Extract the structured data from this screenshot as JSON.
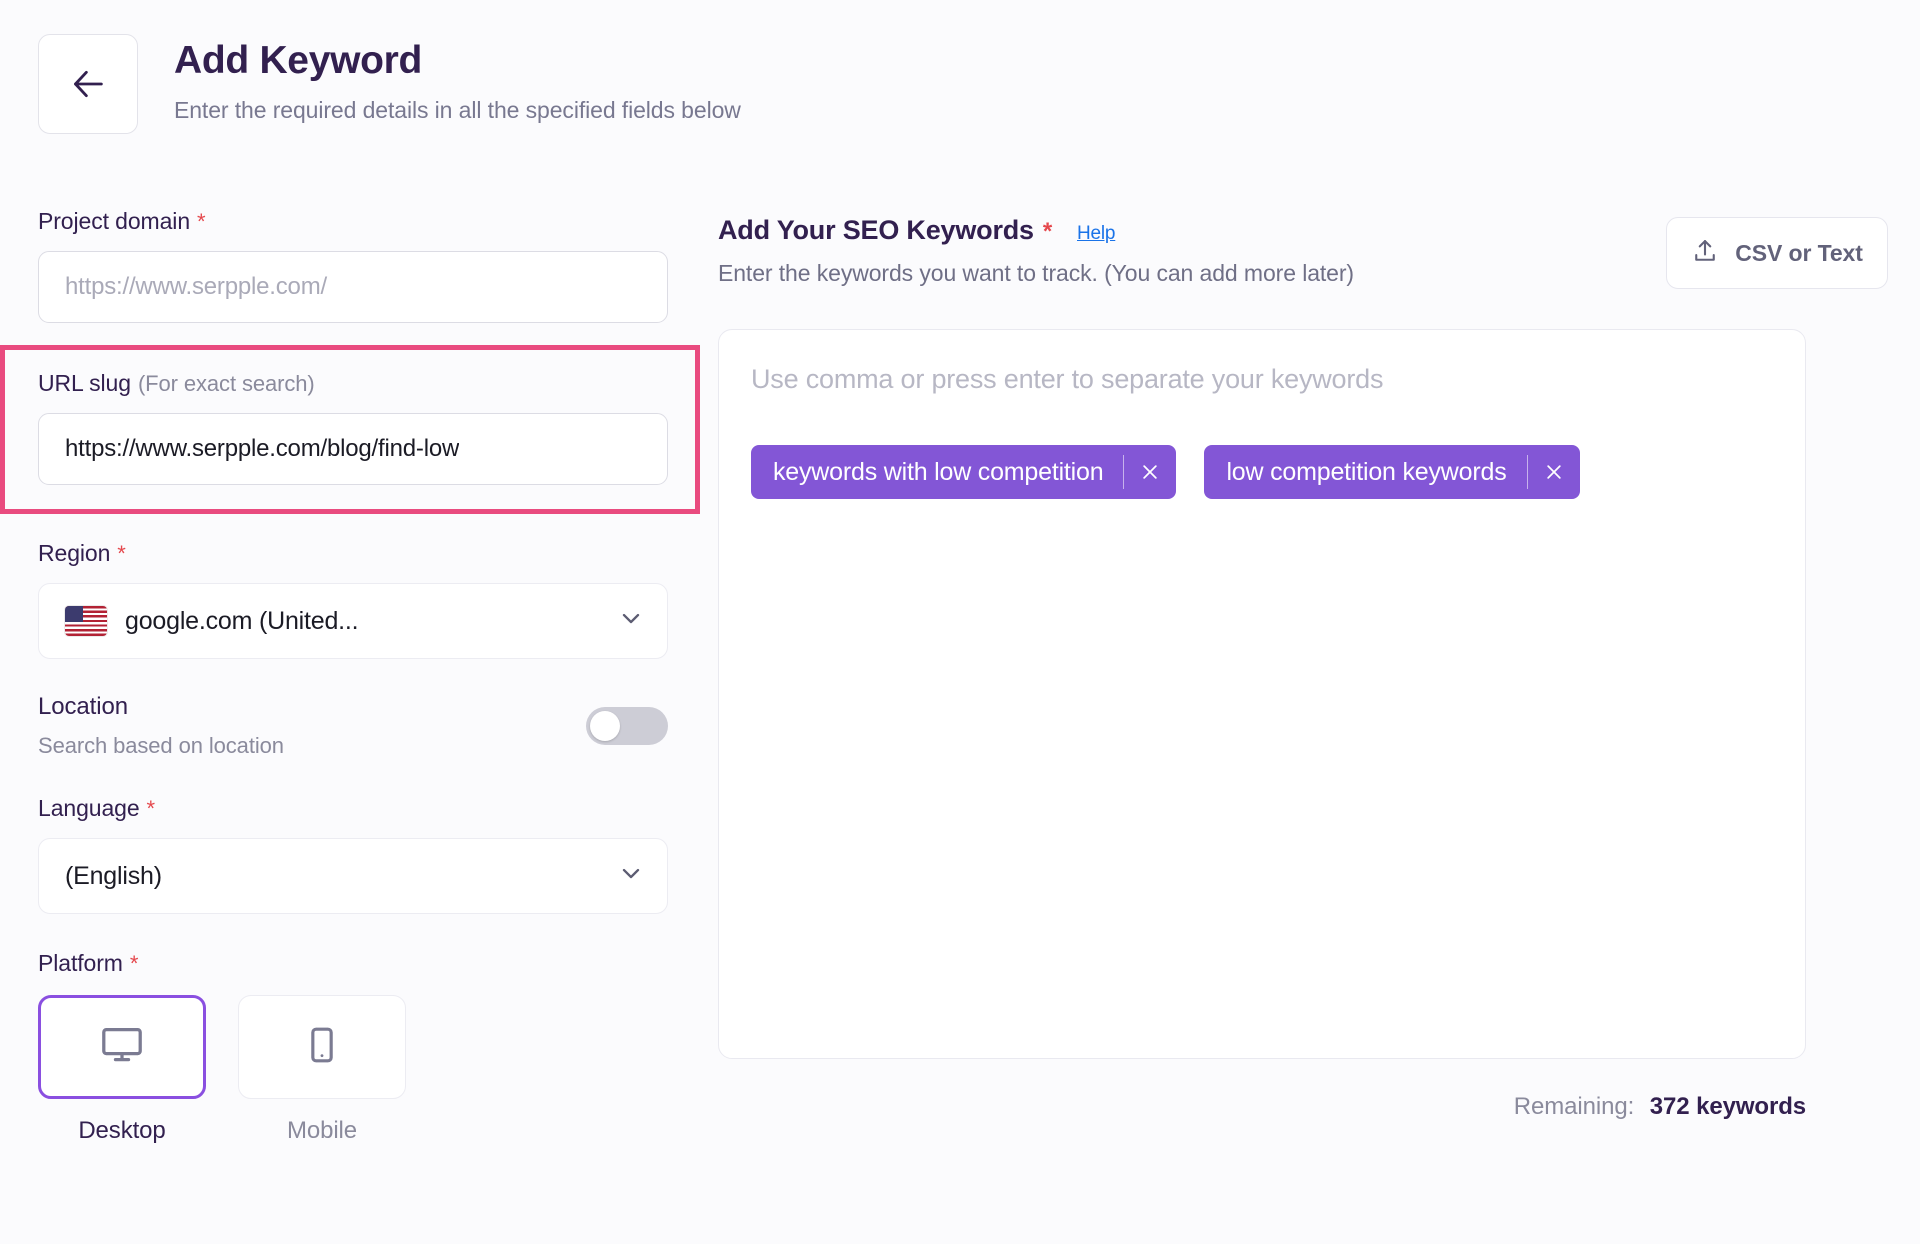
{
  "header": {
    "back_icon": "arrow-left-icon",
    "title": "Add Keyword",
    "subtitle": "Enter the required details in all the specified fields below"
  },
  "colors": {
    "accent_purple": "#8356d6",
    "highlight_pink": "#e94b7f",
    "title_ink": "#32204f",
    "required_red": "#e5484d",
    "link_blue": "#1a73e8"
  },
  "form": {
    "project_domain": {
      "label": "Project domain",
      "required_mark": "*",
      "value": "",
      "placeholder": "https://www.serpple.com/"
    },
    "url_slug": {
      "label": "URL slug",
      "hint": "(For exact search)",
      "value": "https://www.serpple.com/blog/find-low",
      "highlighted": true
    },
    "region": {
      "label": "Region",
      "required_mark": "*",
      "value": "google.com (United...",
      "flag": "us-flag-icon",
      "chevron": "chevron-down-icon"
    },
    "location": {
      "label": "Location",
      "description": "Search based on location",
      "enabled": false
    },
    "language": {
      "label": "Language",
      "required_mark": "*",
      "value": "(English)",
      "chevron": "chevron-down-icon"
    },
    "platform": {
      "label": "Platform",
      "required_mark": "*",
      "options": [
        {
          "label": "Desktop",
          "icon": "desktop-monitor-icon",
          "selected": true
        },
        {
          "label": "Mobile",
          "icon": "mobile-phone-icon",
          "selected": false
        }
      ]
    }
  },
  "keywords_panel": {
    "title": "Add Your SEO Keywords",
    "required_mark": "*",
    "help_label": "Help",
    "subtitle": "Enter the keywords you want to track. (You can add more later)",
    "upload_button": {
      "label": "CSV or Text",
      "icon": "upload-icon"
    },
    "input_placeholder": "Use comma or press enter to separate your keywords",
    "tags": [
      {
        "label": "keywords with low competition",
        "remove_icon": "close-icon"
      },
      {
        "label": "low competition keywords",
        "remove_icon": "close-icon"
      }
    ],
    "remaining_label": "Remaining:",
    "remaining_value": "372 keywords"
  }
}
